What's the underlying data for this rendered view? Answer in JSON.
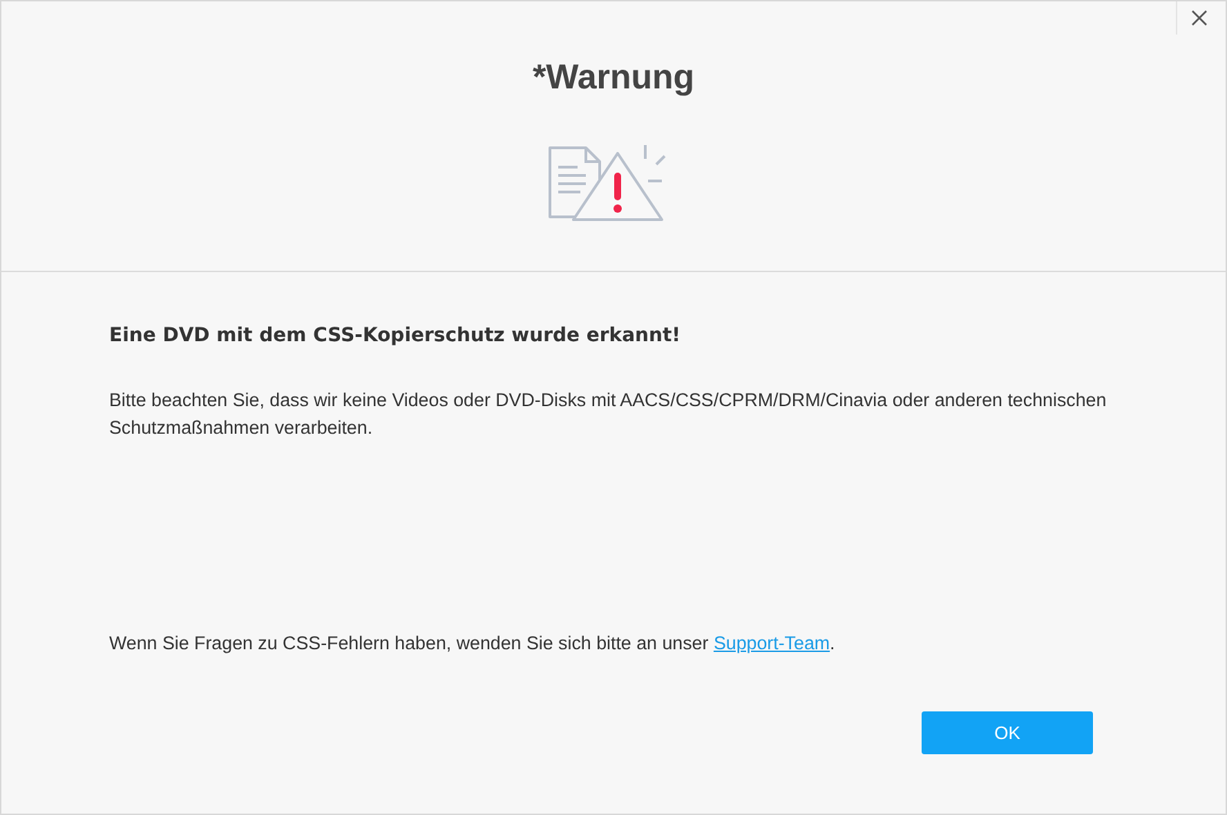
{
  "dialog": {
    "title": "*Warnung"
  },
  "heading": "Eine DVD mit dem CSS-Kopierschutz wurde erkannt!",
  "message": "Bitte beachten Sie, dass wir keine Videos oder DVD-Disks mit AACS/CSS/CPRM/DRM/Cinavia oder anderen technischen Schutzmaßnahmen verarbeiten.",
  "help": {
    "before": "Wenn Sie Fragen zu CSS-Fehlern haben, wenden Sie sich bitte an unser ",
    "link": "Support-Team",
    "after": "."
  },
  "buttons": [
    "OK"
  ]
}
